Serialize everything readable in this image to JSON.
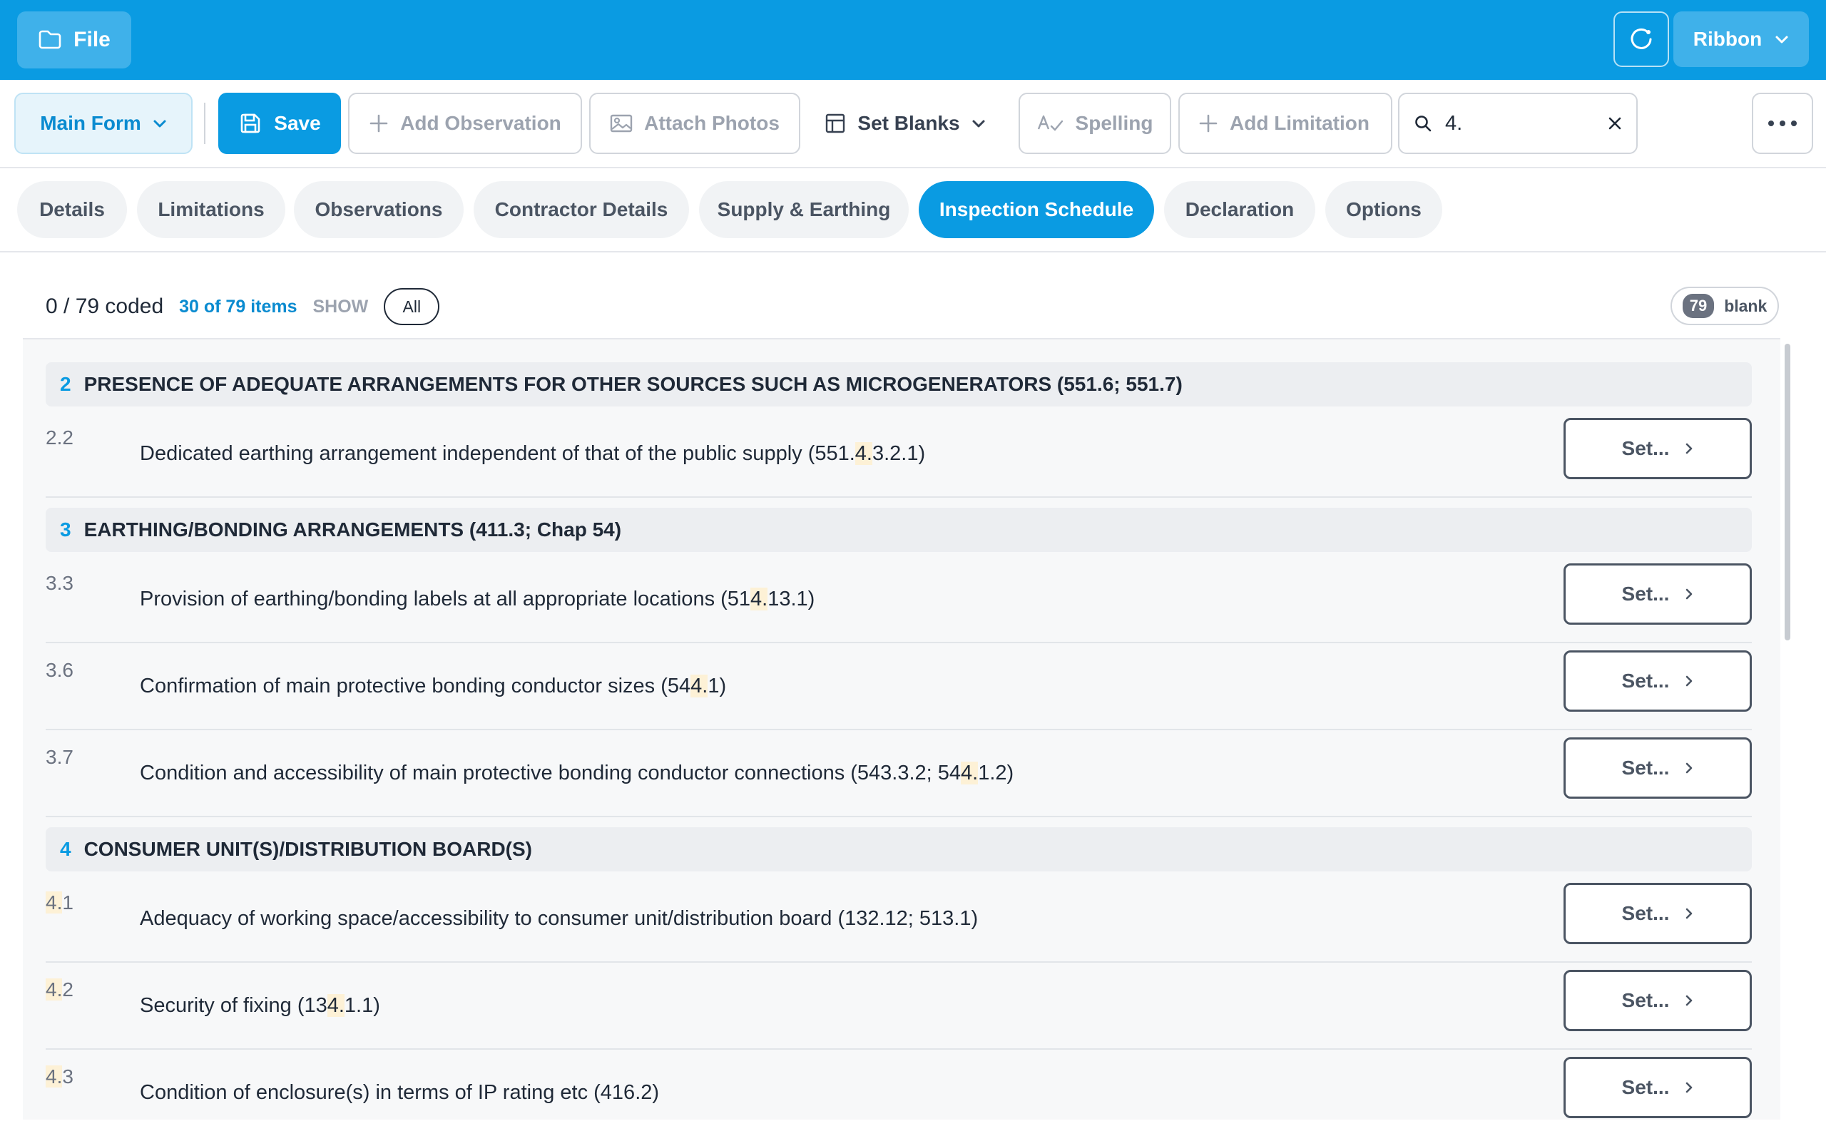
{
  "topbar": {
    "file_label": "File",
    "ribbon_label": "Ribbon"
  },
  "toolbar": {
    "main_form_label": "Main Form",
    "save_label": "Save",
    "add_observation_label": "Add Observation",
    "attach_photos_label": "Attach Photos",
    "set_blanks_label": "Set Blanks",
    "spelling_label": "Spelling",
    "add_limitation_label": "Add Limitation",
    "search_value": "4."
  },
  "tabs": [
    {
      "label": "Details"
    },
    {
      "label": "Limitations"
    },
    {
      "label": "Observations"
    },
    {
      "label": "Contractor Details"
    },
    {
      "label": "Supply & Earthing"
    },
    {
      "label": "Inspection Schedule"
    },
    {
      "label": "Declaration"
    },
    {
      "label": "Options"
    }
  ],
  "active_tab": "Inspection Schedule",
  "summary": {
    "coded": "0 / 79 coded",
    "items_count": "30 of 79 items",
    "show_label": "SHOW",
    "filter": "All",
    "blank_count": "79",
    "blank_label": "blank"
  },
  "set_label": "Set...",
  "sections": [
    {
      "num": "2",
      "title": "PRESENCE OF ADEQUATE ARRANGEMENTS FOR OTHER SOURCES SUCH AS MICROGENERATORS (551.6; 551.7)",
      "items": [
        {
          "num": "2.2",
          "text": "Dedicated earthing arrangement independent of that of the public supply (551.4.3.2.1)"
        }
      ]
    },
    {
      "num": "3",
      "title": "EARTHING/BONDING ARRANGEMENTS (411.3; Chap 54)",
      "items": [
        {
          "num": "3.3",
          "text": "Provision of earthing/bonding labels at all appropriate locations (514.13.1)"
        },
        {
          "num": "3.6",
          "text": "Confirmation of main protective bonding conductor sizes (544.1)"
        },
        {
          "num": "3.7",
          "text": "Condition and accessibility of main protective bonding conductor connections (543.3.2; 544.1.2)"
        }
      ]
    },
    {
      "num": "4",
      "title": "CONSUMER UNIT(S)/DISTRIBUTION BOARD(S)",
      "items": [
        {
          "num": "4.1",
          "text": "Adequacy of working space/accessibility to consumer unit/distribution board (132.12; 513.1)"
        },
        {
          "num": "4.2",
          "text": "Security of fixing (134.1.1)"
        },
        {
          "num": "4.3",
          "text": "Condition of enclosure(s) in terms of IP rating etc (416.2)"
        }
      ]
    }
  ],
  "colors": {
    "accent": "#0a9be2",
    "highlight": "#fdf1d6"
  }
}
